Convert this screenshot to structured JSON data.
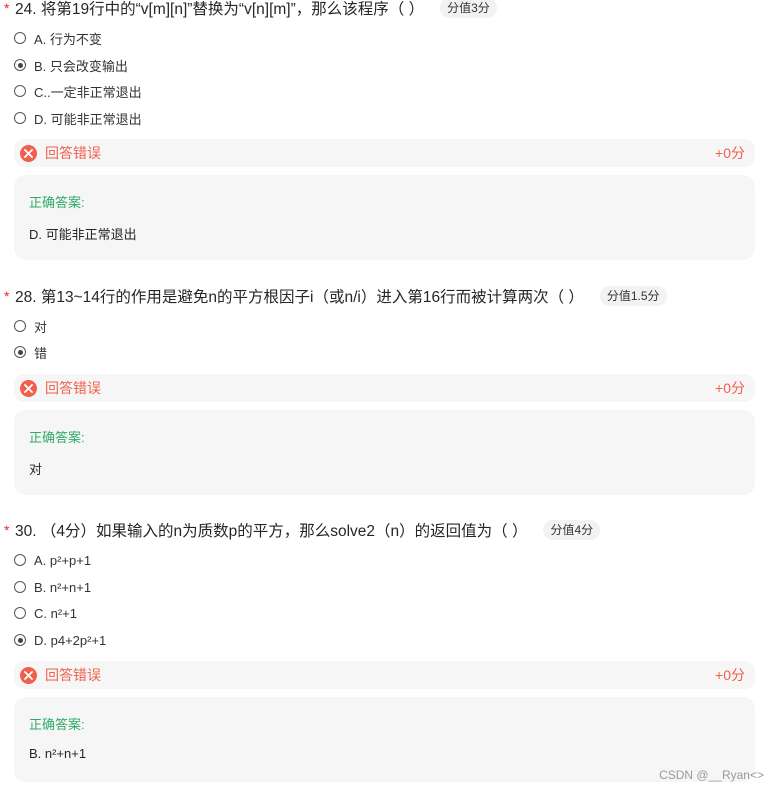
{
  "questions": [
    {
      "star": "*",
      "title": "24. 将第19行中的“v[m][n]”替换为“v[n][m]”，那么该程序（ ）",
      "score_tag": "分值3分",
      "options": [
        {
          "label": "A. 行为不变",
          "selected": false
        },
        {
          "label": "B. 只会改变输出",
          "selected": true
        },
        {
          "label": "C..一定非正常退出",
          "selected": false
        },
        {
          "label": "D. 可能非正常退出",
          "selected": false
        }
      ],
      "result_text": "回答错误",
      "result_score": "+0分",
      "answer_label": "正确答案:",
      "answer_value": "D. 可能非正常退出"
    },
    {
      "star": "*",
      "title": "28. 第13~14行的作用是避免n的平方根因子i（或n/i）进入第16行而被计算两次（ ）",
      "score_tag": "分值1.5分",
      "options": [
        {
          "label": "对",
          "selected": false
        },
        {
          "label": "错",
          "selected": true
        }
      ],
      "result_text": "回答错误",
      "result_score": "+0分",
      "answer_label": "正确答案:",
      "answer_value": "对"
    },
    {
      "star": "*",
      "title": "30. （4分）如果输入的n为质数p的平方，那么solve2（n）的返回值为（ ）",
      "score_tag": "分值4分",
      "options": [
        {
          "label": "A. p²+p+1",
          "selected": false
        },
        {
          "label": "B. n²+n+1",
          "selected": false
        },
        {
          "label": "C. n²+1",
          "selected": false
        },
        {
          "label": "D. p4+2p²+1",
          "selected": true
        }
      ],
      "result_text": "回答错误",
      "result_score": "+0分",
      "answer_label": "正确答案:",
      "answer_value": "B. n²+n+1"
    }
  ],
  "icons": {
    "result": "close-circle-icon",
    "option": "radio-icon"
  },
  "colors": {
    "error": "#f0604c",
    "correct": "#2faa6a",
    "required_star": "#f5222d",
    "panel_bg": "#f6f6f6"
  },
  "watermark": "CSDN @__Ryan<>"
}
